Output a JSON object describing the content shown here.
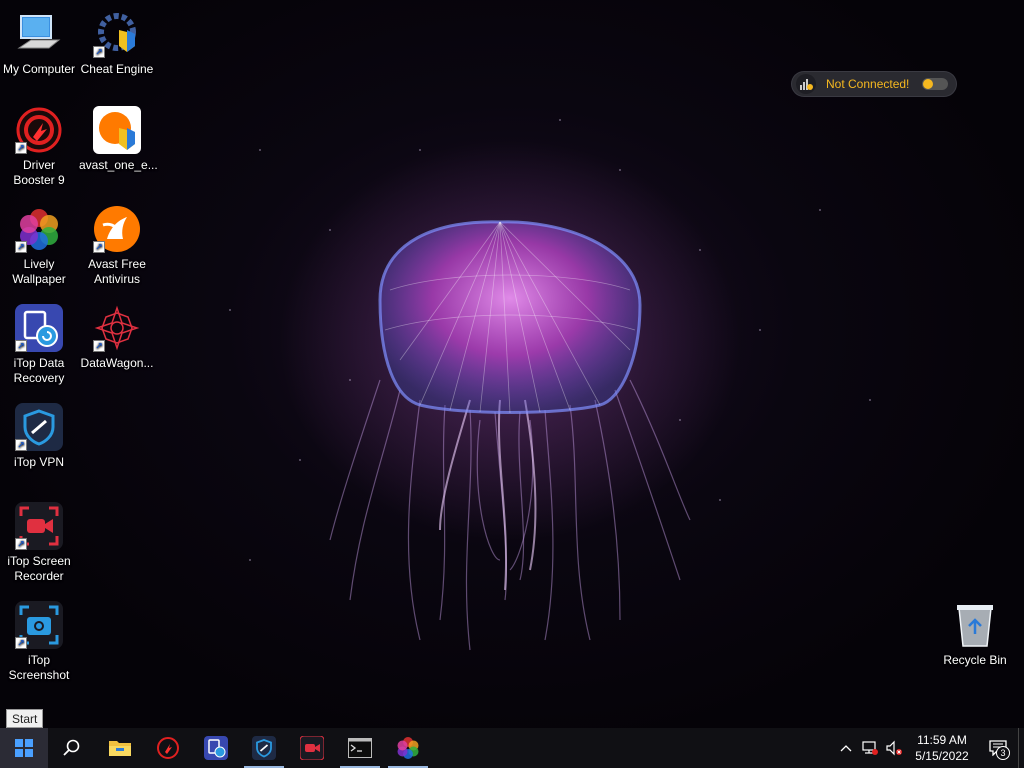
{
  "desktop": {
    "icons": [
      {
        "label": "My Computer"
      },
      {
        "label": "Cheat Engine"
      },
      {
        "label": "Driver Booster 9"
      },
      {
        "label": "avast_one_e..."
      },
      {
        "label": "Lively Wallpaper"
      },
      {
        "label": "Avast Free Antivirus"
      },
      {
        "label": "iTop Data Recovery"
      },
      {
        "label": "DataWagon..."
      },
      {
        "label": "iTop VPN"
      },
      {
        "label": "iTop Screen Recorder"
      },
      {
        "label": "iTop Screenshot"
      },
      {
        "label": "Recycle Bin"
      }
    ]
  },
  "vpn_widget": {
    "status": "Not Connected!",
    "status_color": "#f5b820"
  },
  "start_tooltip": "Start",
  "taskbar": {
    "pinned": [
      {
        "icon": "search-icon"
      },
      {
        "icon": "file-explorer-icon"
      },
      {
        "icon": "driver-booster-icon"
      },
      {
        "icon": "itop-data-recovery-icon"
      },
      {
        "icon": "itop-vpn-icon"
      },
      {
        "icon": "itop-screen-recorder-icon"
      },
      {
        "icon": "command-prompt-icon"
      },
      {
        "icon": "lively-wallpaper-icon"
      }
    ]
  },
  "tray": {
    "time": "11:59 AM",
    "date": "5/15/2022",
    "notification_count": "3"
  },
  "colors": {
    "taskbar_bg": "#101014",
    "accent_blue": "#2a7ad8"
  }
}
